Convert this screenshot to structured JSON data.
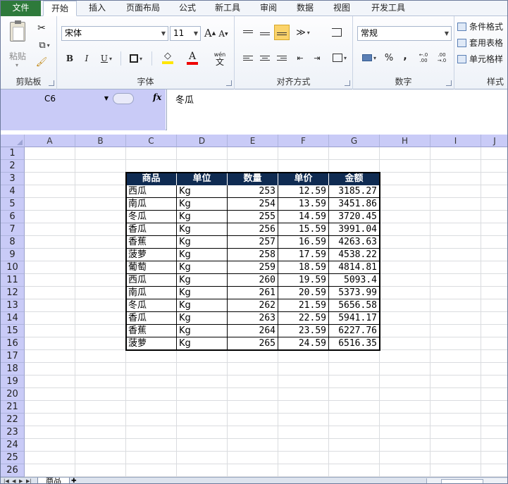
{
  "ribbon": {
    "file_tab": "文件",
    "tabs": [
      "开始",
      "插入",
      "页面布局",
      "公式",
      "新工具",
      "审阅",
      "数据",
      "视图",
      "开发工具"
    ],
    "active_tab": "开始",
    "clipboard": {
      "paste_label": "粘贴",
      "group_label": "剪贴板"
    },
    "font": {
      "name": "宋体",
      "size": "11",
      "group_label": "字体",
      "bold": "B",
      "italic": "I",
      "underline": "U",
      "grow": "A",
      "shrink": "A",
      "font_color": "A",
      "phonetic": "wén"
    },
    "alignment": {
      "group_label": "对齐方式"
    },
    "number": {
      "format": "常规",
      "group_label": "数字",
      "percent": "%",
      "comma": ",",
      "inc_decimal": "←.0 .00",
      "dec_decimal": ".00 →.0"
    },
    "styles": {
      "conditional": "条件格式",
      "table": "套用表格",
      "cell": "单元格样",
      "group_label": "样式"
    }
  },
  "formula_bar": {
    "name_box": "C6",
    "fx": "fx",
    "content": "冬瓜"
  },
  "columns": [
    "A",
    "B",
    "C",
    "D",
    "E",
    "F",
    "G",
    "H",
    "I",
    "J"
  ],
  "rows": [
    "1",
    "2",
    "3",
    "4",
    "5",
    "6",
    "7",
    "8",
    "9",
    "10",
    "11",
    "12",
    "13",
    "14",
    "15",
    "16",
    "17",
    "18",
    "19",
    "20",
    "21",
    "22",
    "23",
    "24",
    "25",
    "26"
  ],
  "table": {
    "headers": [
      "商品",
      "单位",
      "数量",
      "单价",
      "金额"
    ],
    "rows": [
      [
        "西瓜",
        "Kg",
        "253",
        "12.59",
        "3185.27"
      ],
      [
        "南瓜",
        "Kg",
        "254",
        "13.59",
        "3451.86"
      ],
      [
        "冬瓜",
        "Kg",
        "255",
        "14.59",
        "3720.45"
      ],
      [
        "香瓜",
        "Kg",
        "256",
        "15.59",
        "3991.04"
      ],
      [
        "香蕉",
        "Kg",
        "257",
        "16.59",
        "4263.63"
      ],
      [
        "菠萝",
        "Kg",
        "258",
        "17.59",
        "4538.22"
      ],
      [
        "葡萄",
        "Kg",
        "259",
        "18.59",
        "4814.81"
      ],
      [
        "西瓜",
        "Kg",
        "260",
        "19.59",
        "5093.4"
      ],
      [
        "南瓜",
        "Kg",
        "261",
        "20.59",
        "5373.99"
      ],
      [
        "冬瓜",
        "Kg",
        "262",
        "21.59",
        "5656.58"
      ],
      [
        "香瓜",
        "Kg",
        "263",
        "22.59",
        "5941.17"
      ],
      [
        "香蕉",
        "Kg",
        "264",
        "23.59",
        "6227.76"
      ],
      [
        "菠萝",
        "Kg",
        "265",
        "24.59",
        "6516.35"
      ]
    ]
  },
  "sheet_tabs": {
    "active": "商品"
  },
  "colors": {
    "table_header_bg": "#0f2b52",
    "file_tab": "#2e7a3b",
    "header_bg": "#c9cbf7"
  }
}
